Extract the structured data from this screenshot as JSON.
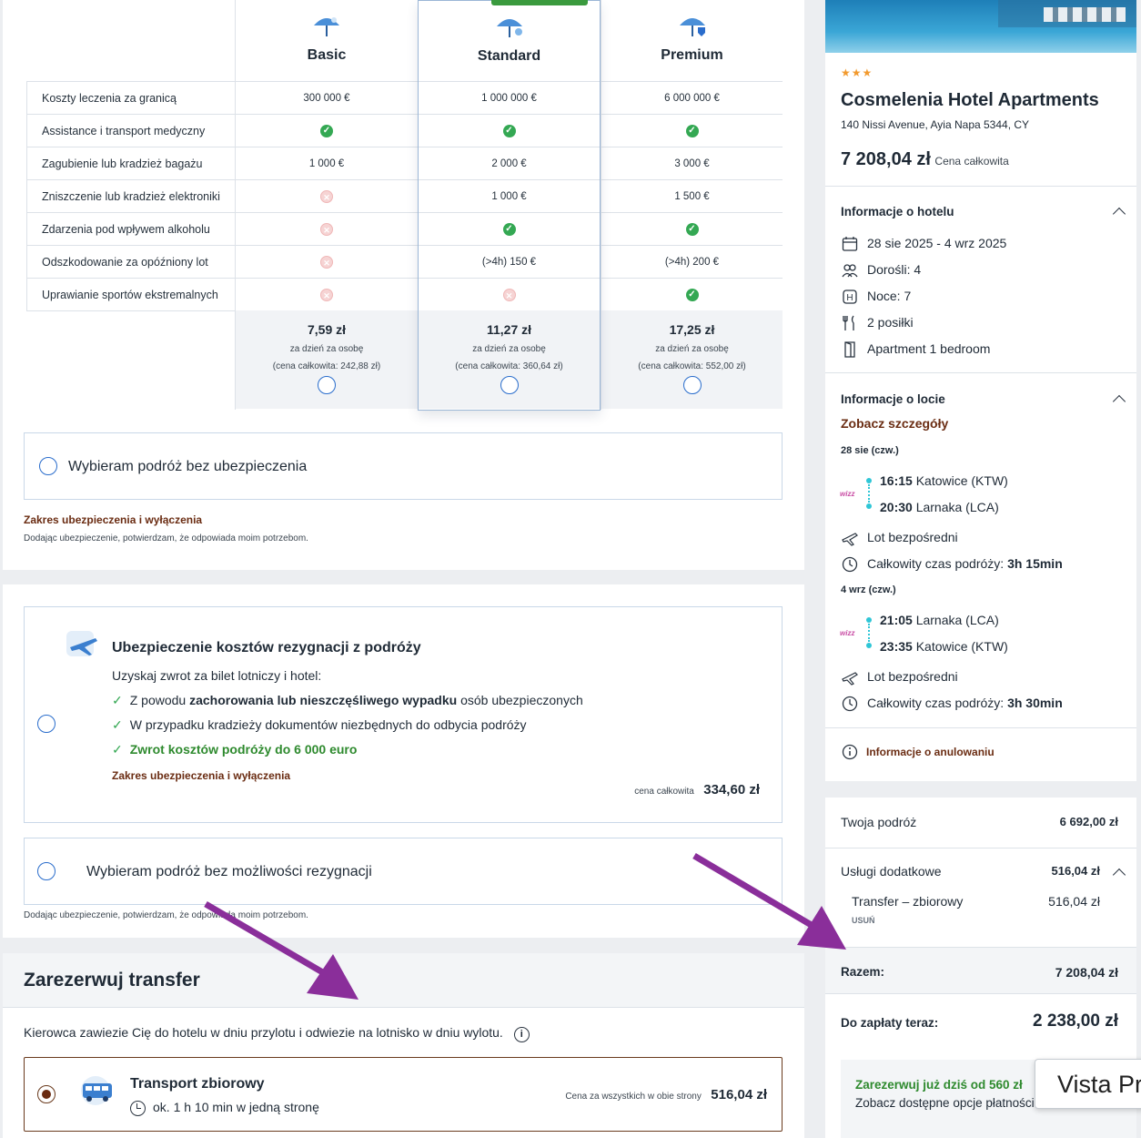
{
  "insurance": {
    "plans": [
      {
        "name": "Basic",
        "price": "7,59 zł",
        "per": "za dzień za osobę",
        "total": "(cena całkowita: 242,88 zł)"
      },
      {
        "name": "Standard",
        "price": "11,27 zł",
        "per": "za dzień za osobę",
        "total": "(cena całkowita: 360,64 zł)"
      },
      {
        "name": "Premium",
        "price": "17,25 zł",
        "per": "za dzień za osobę",
        "total": "(cena całkowita: 552,00 zł)"
      }
    ],
    "rows": [
      {
        "label": "Koszty leczenia za granicą",
        "values": [
          "300 000 €",
          "1 000 000 €",
          "6 000 000 €"
        ]
      },
      {
        "label": "Assistance i transport medyczny",
        "values": [
          "ok",
          "ok",
          "ok"
        ]
      },
      {
        "label": "Zagubienie lub kradzież bagażu",
        "values": [
          "1 000 €",
          "2 000 €",
          "3 000 €"
        ]
      },
      {
        "label": "Zniszczenie lub kradzież elektroniki",
        "values": [
          "no",
          "1 000 €",
          "1 500 €"
        ]
      },
      {
        "label": "Zdarzenia pod wpływem alkoholu",
        "values": [
          "no",
          "ok",
          "ok"
        ]
      },
      {
        "label": "Odszkodowanie za opóźniony lot",
        "values": [
          "no",
          "(>4h) 150 €",
          "(>4h) 200 €"
        ]
      },
      {
        "label": "Uprawianie sportów ekstremalnych",
        "values": [
          "no",
          "no",
          "ok"
        ]
      }
    ],
    "no_insurance_label": "Wybieram podróż bez ubezpieczenia",
    "scope_link": "Zakres ubezpieczenia i wyłączenia",
    "confirm_note": "Dodając ubezpieczenie, potwierdzam, że odpowiada moim potrzebom."
  },
  "cancellation": {
    "title": "Ubezpieczenie kosztów rezygnacji z podróży",
    "intro": "Uzyskaj zwrot za bilet lotniczy i hotel:",
    "bullet1_pre": "Z powodu ",
    "bullet1_bold": "zachorowania lub nieszczęśliwego wypadku",
    "bullet1_post": " osób ubezpieczonych",
    "bullet2": "W przypadku kradzieży dokumentów niezbędnych do odbycia podróży",
    "bullet3": "Zwrot kosztów podróży do 6 000 euro",
    "scope_link": "Zakres ubezpieczenia i wyłączenia",
    "price_label": "cena całkowita",
    "price": "334,60 zł",
    "no_cancel_label": "Wybieram podróż bez możliwości rezygnacji",
    "confirm_note": "Dodając ubezpieczenie, potwierdzam, że odpowiada moim potrzebom."
  },
  "transfer": {
    "title": "Zarezerwuj transfer",
    "desc": "Kierowca zawiezie Cię do hotelu w dniu przylotu i odwiezie na lotnisko w dniu wylotu.",
    "option_name": "Transport zbiorowy",
    "option_time": "ok. 1 h 10 min w jedną stronę",
    "price_label": "Cena za wszystkich w obie strony",
    "price": "516,04 zł"
  },
  "hotel": {
    "stars": "★★★",
    "name": "Cosmelenia Hotel Apartments",
    "address": "140 Nissi Avenue, Ayia Napa 5344, CY",
    "price": "7 208,04 zł",
    "price_label": "Cena całkowita",
    "info_title": "Informacje o hotelu",
    "dates": "28 sie 2025 - 4 wrz 2025",
    "adults": "Dorośli: 4",
    "nights": "Noce: 7",
    "meals": "2 posiłki",
    "room": "Apartment 1 bedroom"
  },
  "flight": {
    "title": "Informacje o locie",
    "details_link": "Zobacz szczegóły",
    "out_date": "28 sie (czw.)",
    "out_dep_time": "16:15",
    "out_dep_place": " Katowice (KTW)",
    "out_arr_time": "20:30",
    "out_arr_place": " Larnaka (LCA)",
    "direct": "Lot bezpośredni",
    "out_duration_label": "Całkowity czas podróży: ",
    "out_duration": "3h 15min",
    "ret_date": "4 wrz (czw.)",
    "ret_dep_time": "21:05",
    "ret_dep_place": " Larnaka (LCA)",
    "ret_arr_time": "23:35",
    "ret_arr_place": " Katowice (KTW)",
    "ret_duration_label": "Całkowity czas podróży: ",
    "ret_duration": "3h 30min",
    "airline": "wizz",
    "cancel_info": "Informacje o anulowaniu"
  },
  "summary": {
    "trip_label": "Twoja podróż",
    "trip_value": "6 692,00 zł",
    "extras_label": "Usługi dodatkowe",
    "extras_value": "516,04 zł",
    "transfer_label": "Transfer – zbiorowy",
    "transfer_value": "516,04 zł",
    "remove": "USUŃ",
    "total_label": "Razem:",
    "total_value": "7 208,04 zł",
    "pay_now_label": "Do zapłaty teraz:",
    "pay_now_value": "2 238,00 zł",
    "promo_title": "Zarezerwuj już dziś od 560 zł",
    "promo_sub": "Zobacz dostępne opcje płatności",
    "tooltip": "Vista Pr"
  },
  "colors": {
    "accent_green": "#3a9a3e",
    "brand_brown": "#6a2c12",
    "arrow_purple": "#8a2e9a",
    "radio_blue": "#2a6dcc"
  }
}
